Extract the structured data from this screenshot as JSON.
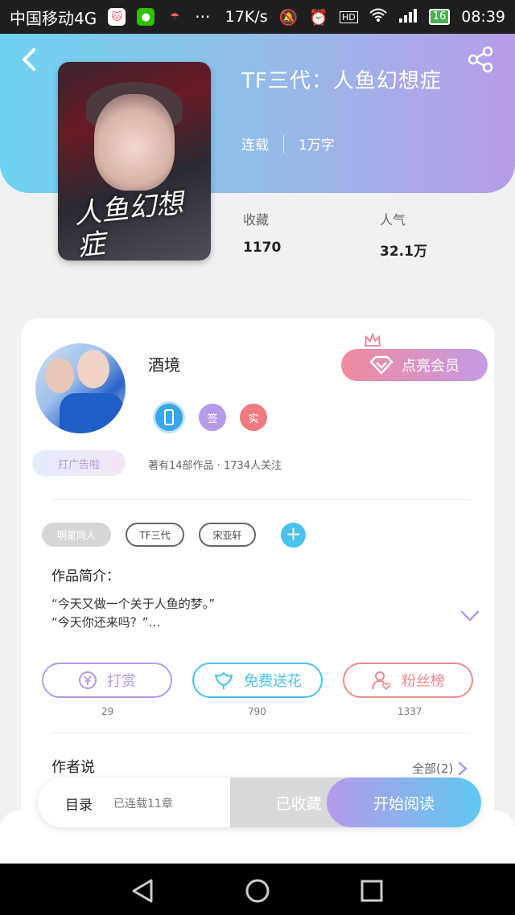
{
  "status_bar": {
    "carrier": "中国移动4G",
    "speed": "17K/s",
    "battery": "16",
    "time": "08:39",
    "icons": [
      "cat-app-icon",
      "wechat-icon",
      "umbrella-app-icon",
      "more-icon",
      "mute-icon",
      "alarm-icon",
      "hd-icon",
      "wifi-icon",
      "signal-icon",
      "battery-icon"
    ]
  },
  "book": {
    "title": "TF三代：人鱼幻想症",
    "status": "连载",
    "word_count": "1万字",
    "cover_title": "人鱼幻想症",
    "stats": [
      {
        "label": "收藏",
        "value": "1170"
      },
      {
        "label": "人气",
        "value": "32.1万"
      }
    ]
  },
  "author": {
    "name": "酒境",
    "badges": [
      "签",
      "实"
    ],
    "ad_tag": "打广告啦",
    "summary": "著有14部作品 · 1734人关注",
    "vip_button": "点亮会员"
  },
  "tags": [
    "明星同人",
    "TF三代",
    "宋亚轩"
  ],
  "intro": {
    "label": "作品简介：",
    "lines": [
      "“今天又做一个关于人鱼的梦。”",
      "“今天你还来吗？”…"
    ]
  },
  "actions": [
    {
      "label": "打赏",
      "count": "29",
      "color": "#b59ae8",
      "icon": "yuan-coin-icon"
    },
    {
      "label": "免费送花",
      "count": "790",
      "color": "#48c2ee",
      "icon": "flower-icon"
    },
    {
      "label": "粉丝榜",
      "count": "1337",
      "color": "#ee8a8e",
      "icon": "fan-user-icon"
    }
  ],
  "author_says": {
    "label": "作者说",
    "all_link": "全部(2)"
  },
  "bottom_bar": {
    "toc": "目录",
    "chapters": "已连载11章",
    "collected": "已收藏",
    "start_reading": "开始阅读"
  }
}
